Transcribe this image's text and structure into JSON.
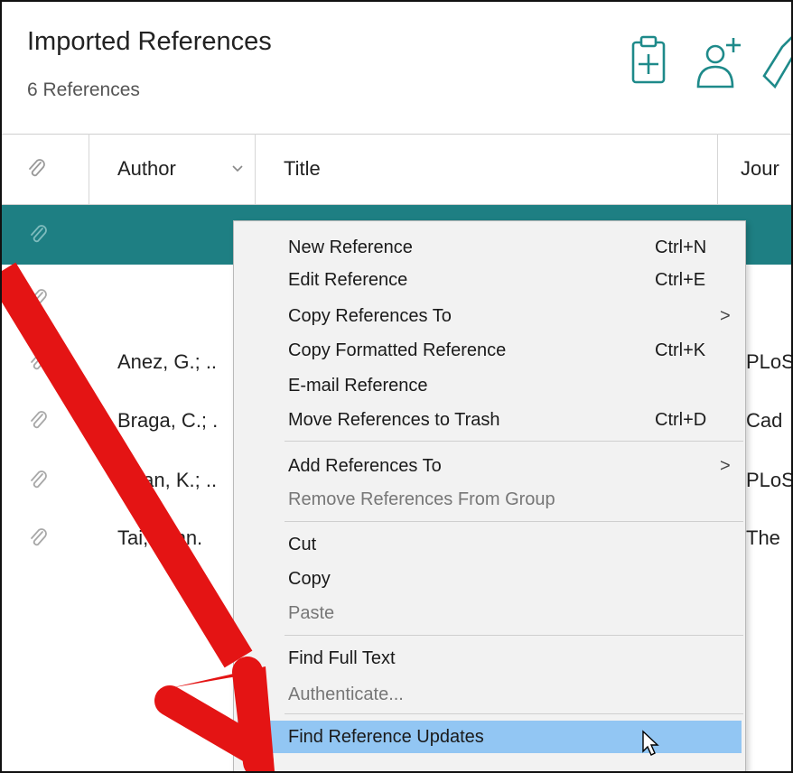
{
  "header": {
    "title": "Imported References",
    "subtitle": "6 References",
    "icons": [
      "clipboard-add-icon",
      "add-person-icon",
      "tag-icon"
    ]
  },
  "columns": {
    "author": "Author",
    "title": "Title",
    "journal": "Jour"
  },
  "rows": [
    {
      "author": "",
      "journal": ""
    },
    {
      "author": "",
      "journal": ""
    },
    {
      "author": "Anez, G.; ..",
      "journal": "PLoS"
    },
    {
      "author": "Braga, C.; .",
      "journal": "Cad"
    },
    {
      "author": "Chan, K.; ..",
      "journal": "PLoS"
    },
    {
      "author": "Tai, John.",
      "journal": "The"
    }
  ],
  "menu": {
    "new_reference": {
      "label": "New Reference",
      "shortcut": "Ctrl+N"
    },
    "edit_reference": {
      "label": "Edit Reference",
      "shortcut": "Ctrl+E"
    },
    "copy_references_to": {
      "label": "Copy References To",
      "submenu": ">"
    },
    "copy_formatted": {
      "label": "Copy Formatted Reference",
      "shortcut": "Ctrl+K"
    },
    "email_reference": {
      "label": "E-mail Reference"
    },
    "move_to_trash": {
      "label": "Move References to Trash",
      "shortcut": "Ctrl+D"
    },
    "add_references_to": {
      "label": "Add References To",
      "submenu": ">"
    },
    "remove_from_group": {
      "label": "Remove References From Group"
    },
    "cut": {
      "label": "Cut"
    },
    "copy": {
      "label": "Copy"
    },
    "paste": {
      "label": "Paste"
    },
    "find_full_text": {
      "label": "Find Full Text"
    },
    "authenticate": {
      "label": "Authenticate..."
    },
    "find_reference_updates": {
      "label": "Find Reference Updates"
    }
  },
  "colors": {
    "selected_row": "#1e7f83",
    "menu_highlight": "#92c6f3",
    "accent_icon": "#1e8a8a",
    "annotation_arrow": "#e41414"
  }
}
